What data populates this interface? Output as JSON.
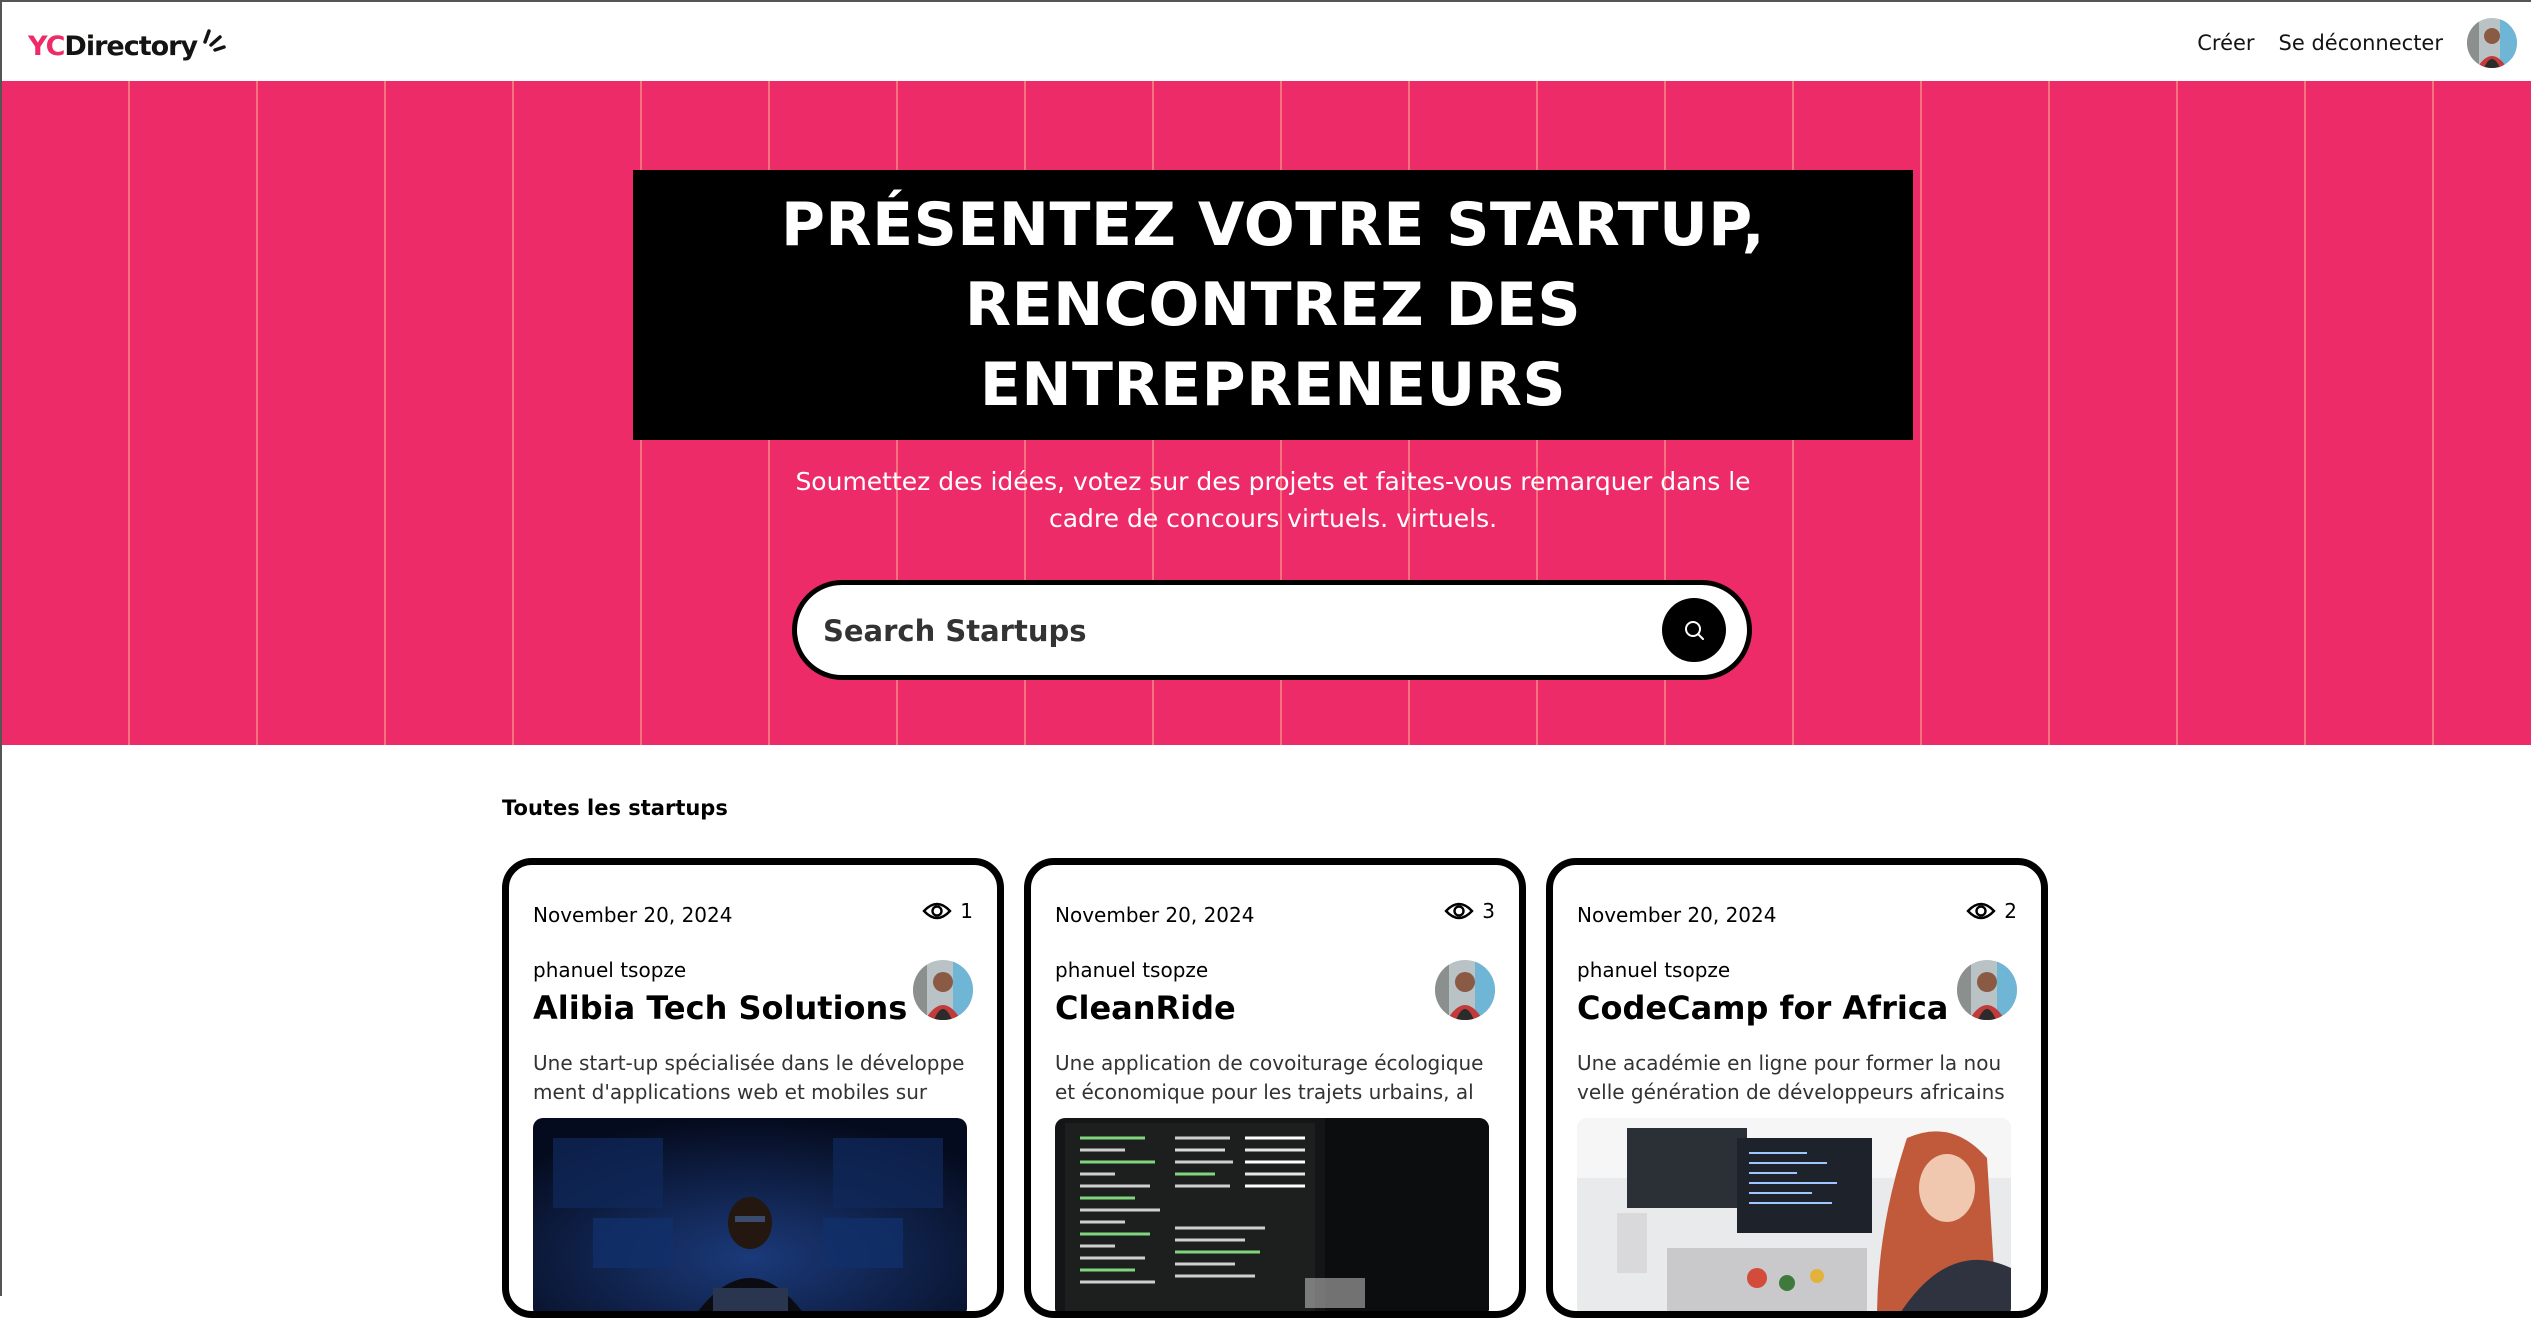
{
  "nav": {
    "logo_yc": "YC",
    "logo_rest": "Directory",
    "create_label": "Créer",
    "logout_label": "Se déconnecter"
  },
  "hero": {
    "heading_line1": "PRÉSENTEZ VOTRE STARTUP,",
    "heading_line2": "RENCONTREZ DES",
    "heading_line3": "ENTREPRENEURS",
    "subtitle": "Soumettez des idées, votez sur des projets et faites-vous remarquer dans le cadre de concours virtuels. virtuels.",
    "search_placeholder": "Search Startups",
    "accent_color": "#EE2B69"
  },
  "section": {
    "title": "Toutes les startups"
  },
  "cards": [
    {
      "date": "November 20, 2024",
      "views": "1",
      "author": "phanuel tsopze",
      "title": "Alibia Tech Solutions",
      "description": "Une start-up spécialisée dans le développement d'applications web et mobiles sur m...",
      "image": "person-at-computer-dark-office"
    },
    {
      "date": "November 20, 2024",
      "views": "3",
      "author": "phanuel tsopze",
      "title": "CleanRide",
      "description": "Une application de covoiturage écologique et économique pour les trajets urbains, ali...",
      "image": "terminal-screens"
    },
    {
      "date": "November 20, 2024",
      "views": "2",
      "author": "phanuel tsopze",
      "title": "CodeCamp for Africa",
      "description": "Une académie en ligne pour former la nouvelle génération de développeurs africains ...",
      "image": "woman-coding-office"
    }
  ]
}
